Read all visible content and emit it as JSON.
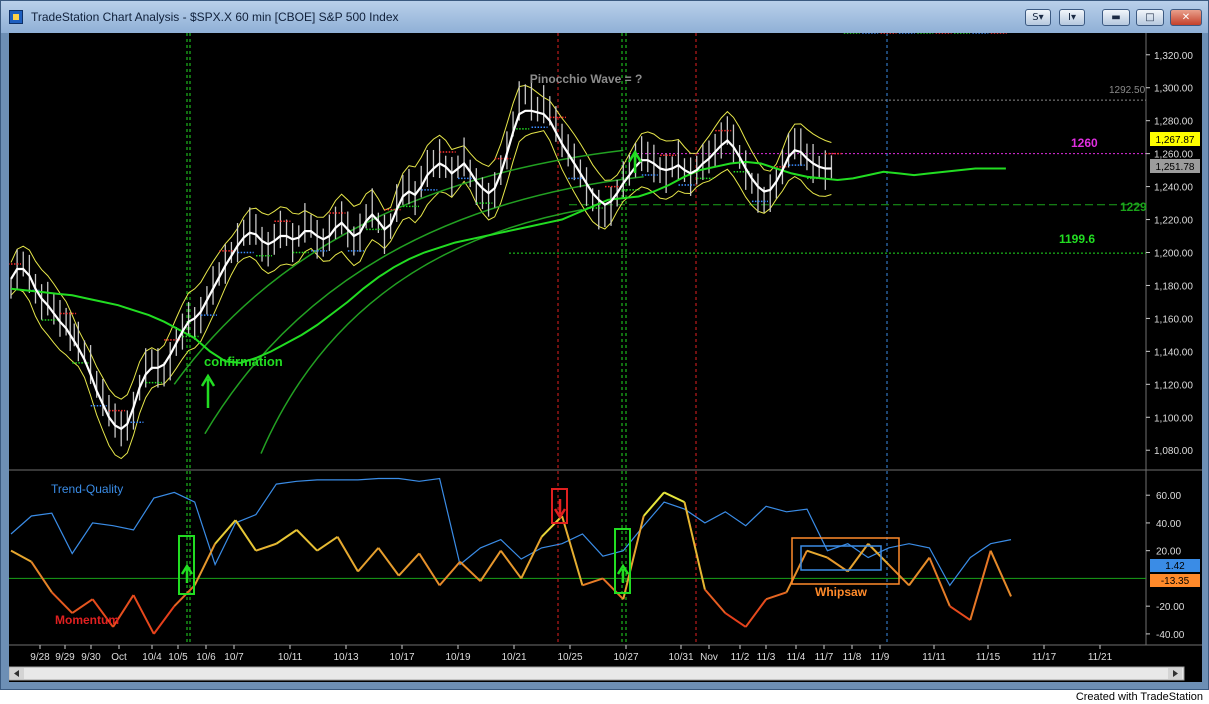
{
  "window": {
    "title": "TradeStation Chart Analysis - $SPX.X 60 min [CBOE] S&P 500 Index",
    "buttons": {
      "style_symbol": "S",
      "indicator_symbol": "I"
    }
  },
  "annotations": {
    "pinocchio": "Pinocchio Wave = ?",
    "confirmation": "confirmation",
    "whipsaw": "Whipsaw",
    "trend_quality": "Trend-Quality",
    "momentum": "Momentum",
    "level_1292": "1292.50",
    "level_1260": "1260",
    "level_1229": "1229",
    "level_1199": "1199.6"
  },
  "price_badges": {
    "yellow": "1,267.87",
    "gray": "1,251.78"
  },
  "lower_badges": {
    "blue": "1.42",
    "orange": "-13.35"
  },
  "credit": "Created with TradeStation",
  "colors": {
    "price_bar": "#c8c8c8",
    "sma": "#ffffff",
    "ma_long": "#22dd22",
    "bands": "#e6e64a",
    "trend_quality": "#3a8ce6",
    "momentum_hi": "#ffe040",
    "momentum_lo": "#e02020"
  },
  "chart_data": [
    {
      "type": "line",
      "title": "TradeStation Chart Analysis - $SPX.X 60 min [CBOE] S&P 500 Index",
      "x_labels": [
        "9/28",
        "9/29",
        "9/30",
        "Oct",
        "10/4",
        "10/5",
        "10/6",
        "10/7",
        "10/11",
        "10/13",
        "10/17",
        "10/19",
        "10/21",
        "10/25",
        "10/27",
        "10/31",
        "Nov",
        "11/2",
        "11/3",
        "11/4",
        "11/7",
        "11/8",
        "11/9",
        "11/11",
        "11/15",
        "11/17",
        "11/21"
      ],
      "y_ticks": [
        "1,080.00",
        "1,100.00",
        "1,120.00",
        "1,140.00",
        "1,160.00",
        "1,180.00",
        "1,200.00",
        "1,220.00",
        "1,240.00",
        "1,260.00",
        "1,280.00",
        "1,300.00",
        "1,320.00"
      ],
      "ylim": [
        1068,
        1332
      ],
      "series": [
        {
          "x": [
            0,
            6,
            12,
            18,
            24,
            30,
            36,
            42,
            48,
            54,
            58,
            62,
            66,
            72,
            78,
            84,
            90,
            96,
            102,
            108,
            114,
            120,
            126,
            132,
            138,
            144,
            150,
            156,
            162,
            168,
            174,
            180,
            186,
            192,
            198,
            204,
            210,
            216,
            222,
            228,
            234,
            240,
            246,
            252,
            258,
            264,
            270,
            276,
            282,
            288,
            294,
            300,
            306,
            312,
            318,
            324,
            330,
            336,
            342,
            348,
            354,
            360,
            366,
            372,
            378,
            384,
            390,
            396,
            402,
            408,
            414,
            420,
            426,
            432,
            438,
            444,
            450,
            456,
            462,
            468,
            474,
            480,
            486,
            492,
            498,
            504,
            510,
            516,
            522,
            528,
            534,
            540,
            546,
            552,
            558,
            564,
            570,
            576,
            582,
            588,
            594,
            600,
            606,
            612,
            618,
            624,
            630,
            636,
            642,
            648,
            654,
            660,
            666,
            672,
            678,
            684,
            690,
            696,
            702,
            708,
            714,
            720,
            726,
            732,
            738,
            744,
            750,
            756,
            762,
            768,
            774,
            780,
            786,
            792,
            798,
            804,
            810,
            816,
            822,
            828,
            834,
            840,
            846,
            852,
            858,
            864,
            870,
            876,
            882,
            888,
            894,
            900,
            906,
            912,
            918,
            924,
            930,
            936,
            942,
            948,
            954,
            960,
            966,
            972,
            978
          ],
          "close": [
            1178,
            1190,
            1193,
            1187,
            1178,
            1170,
            1172,
            1166,
            1160,
            1158,
            1152,
            1150,
            1146,
            1140,
            1132,
            1120,
            1112,
            1104,
            1098,
            1093,
            1095,
            1104,
            1118,
            1130,
            1135,
            1130,
            1126,
            1134,
            1146,
            1152,
            1160,
            1157,
            1162,
            1171,
            1180,
            1187,
            1193,
            1200,
            1206,
            1212,
            1216,
            1214,
            1205,
            1202,
            1208,
            1214,
            1212,
            1206,
            1210,
            1218,
            1216,
            1208,
            1206,
            1212,
            1218,
            1221,
            1214,
            1207,
            1212,
            1222,
            1227,
            1218,
            1211,
            1216,
            1230,
            1238,
            1240,
            1233,
            1243,
            1251,
            1254,
            1257,
            1252,
            1246,
            1252,
            1258,
            1248,
            1240,
            1236,
            1232,
            1238,
            1250,
            1262,
            1278,
            1292,
            1296,
            1292,
            1287,
            1290,
            1286,
            1278,
            1268,
            1262,
            1255,
            1248,
            1240,
            1232,
            1226,
            1222,
            1228,
            1236,
            1244,
            1250,
            1256,
            1260,
            1258,
            1254,
            1250,
            1248,
            1252,
            1256,
            1250,
            1246,
            1250,
            1255,
            1258,
            1262,
            1268,
            1274,
            1266,
            1258,
            1250,
            1242,
            1236,
            1232,
            1236,
            1242,
            1252,
            1262,
            1266,
            1264,
            1258,
            1254,
            1252,
            1250,
            1252
          ],
          "sma": [
            1184,
            1190,
            1190,
            1186,
            1178,
            1172,
            1168,
            1163,
            1158,
            1154,
            1150,
            1146,
            1142,
            1135,
            1126,
            1116,
            1108,
            1100,
            1095,
            1093,
            1096,
            1106,
            1118,
            1126,
            1130,
            1130,
            1132,
            1138,
            1145,
            1152,
            1158,
            1160,
            1164,
            1171,
            1178,
            1185,
            1192,
            1198,
            1204,
            1209,
            1212,
            1211,
            1207,
            1205,
            1207,
            1210,
            1210,
            1208,
            1209,
            1213,
            1213,
            1210,
            1208,
            1210,
            1215,
            1218,
            1214,
            1210,
            1212,
            1219,
            1223,
            1219,
            1214,
            1217,
            1226,
            1234,
            1237,
            1235,
            1240,
            1247,
            1251,
            1254,
            1252,
            1248,
            1251,
            1254,
            1249,
            1243,
            1239,
            1236,
            1239,
            1248,
            1260,
            1273,
            1284,
            1286,
            1286,
            1285,
            1284,
            1280,
            1273,
            1266,
            1260,
            1254,
            1248,
            1242,
            1236,
            1232,
            1229,
            1231,
            1236,
            1242,
            1247,
            1252,
            1256,
            1256,
            1254,
            1251,
            1250,
            1251,
            1253,
            1250,
            1248,
            1250,
            1254,
            1257,
            1261,
            1265,
            1268,
            1264,
            1258,
            1251,
            1245,
            1240,
            1237,
            1238,
            1243,
            1250,
            1258,
            1262,
            1261,
            1257,
            1254,
            1252,
            1251,
            1251
          ],
          "ma_long": [
            1178,
            1177,
            1176,
            1175,
            1174,
            1172,
            1170,
            1168,
            1165,
            1162,
            1158,
            1153,
            1148,
            1140,
            1134,
            1133,
            1136,
            1140,
            1145,
            1150,
            1156,
            1163,
            1170,
            1178,
            1185,
            1191,
            1196,
            1200,
            1203,
            1206,
            1208,
            1210,
            1212,
            1214,
            1216,
            1218,
            1220,
            1224,
            1228,
            1232,
            1233,
            1234,
            1237,
            1241,
            1246,
            1250,
            1252,
            1254,
            1255,
            1254,
            1251,
            1248,
            1246,
            1245,
            1244,
            1245,
            1247,
            1249,
            1248,
            1247,
            1248,
            1249,
            1250,
            1251,
            1251,
            1251
          ]
        }
      ],
      "levels": [
        1292.5,
        1260,
        1229,
        1199.6
      ],
      "legend": "none",
      "grid": false
    },
    {
      "type": "line",
      "y_ticks": [
        "60.00",
        "40.00",
        "20.00",
        "-20.00",
        "-40.00"
      ],
      "ylim": [
        -48,
        76
      ],
      "series": [
        {
          "name": "Trend-Quality",
          "x": [
            0,
            20,
            40,
            60,
            80,
            100,
            120,
            140,
            160,
            180,
            200,
            220,
            240,
            260,
            280,
            300,
            320,
            340,
            360,
            380,
            400,
            420,
            440,
            460,
            480,
            500,
            520,
            540,
            560,
            580,
            600,
            620,
            640,
            660,
            680,
            700,
            720,
            740,
            760,
            780,
            800,
            820,
            840,
            860,
            880,
            900,
            920,
            940,
            960,
            980
          ],
          "values": [
            32,
            45,
            47,
            18,
            40,
            38,
            35,
            58,
            62,
            55,
            10,
            40,
            46,
            68,
            70,
            71,
            71,
            71,
            72,
            72,
            70,
            72,
            10,
            22,
            28,
            14,
            22,
            25,
            32,
            16,
            20,
            38,
            55,
            50,
            40,
            48,
            38,
            52,
            48,
            50,
            20,
            25,
            15,
            22,
            25,
            22,
            -5,
            15,
            25,
            28
          ]
        },
        {
          "name": "Momentum",
          "x": [
            0,
            20,
            40,
            60,
            80,
            100,
            120,
            140,
            160,
            180,
            200,
            220,
            240,
            260,
            280,
            300,
            320,
            340,
            360,
            380,
            400,
            420,
            440,
            460,
            480,
            500,
            520,
            540,
            560,
            580,
            600,
            620,
            640,
            660,
            680,
            700,
            720,
            740,
            760,
            780,
            800,
            820,
            840,
            860,
            880,
            900,
            920,
            940,
            960,
            980
          ],
          "values": [
            20,
            12,
            -10,
            -25,
            -15,
            -35,
            -12,
            -40,
            -20,
            -5,
            25,
            42,
            20,
            25,
            35,
            20,
            30,
            5,
            22,
            2,
            18,
            -5,
            12,
            -2,
            20,
            0,
            30,
            45,
            -5,
            0,
            -15,
            45,
            62,
            55,
            -8,
            -25,
            -35,
            -15,
            -10,
            20,
            15,
            5,
            25,
            10,
            -5,
            15,
            -20,
            -30,
            20,
            -13
          ]
        }
      ],
      "legend": "none",
      "grid": false
    }
  ]
}
